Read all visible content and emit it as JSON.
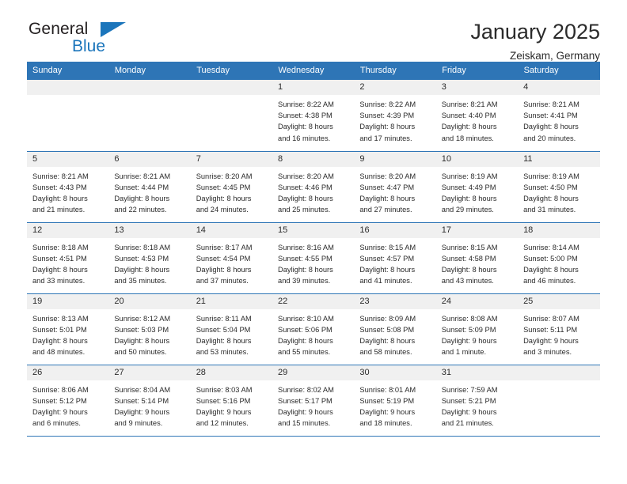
{
  "brand": {
    "line1": "General",
    "line2": "Blue",
    "triangle_icon": "blue-triangle-icon",
    "color_dark": "#231f20",
    "color_blue": "#1b75bb"
  },
  "header": {
    "title": "January 2025",
    "subtitle": "Zeiskam, Germany"
  },
  "colors": {
    "header_row": "#2e75b6",
    "daynum_band": "#f0f0f0",
    "text": "#2b2b2b"
  },
  "weekday_headers": [
    "Sunday",
    "Monday",
    "Tuesday",
    "Wednesday",
    "Thursday",
    "Friday",
    "Saturday"
  ],
  "weeks": [
    [
      {
        "day": "",
        "sunrise": "",
        "sunset": "",
        "daylight1": "",
        "daylight2": ""
      },
      {
        "day": "",
        "sunrise": "",
        "sunset": "",
        "daylight1": "",
        "daylight2": ""
      },
      {
        "day": "",
        "sunrise": "",
        "sunset": "",
        "daylight1": "",
        "daylight2": ""
      },
      {
        "day": "1",
        "sunrise": "Sunrise: 8:22 AM",
        "sunset": "Sunset: 4:38 PM",
        "daylight1": "Daylight: 8 hours",
        "daylight2": "and 16 minutes."
      },
      {
        "day": "2",
        "sunrise": "Sunrise: 8:22 AM",
        "sunset": "Sunset: 4:39 PM",
        "daylight1": "Daylight: 8 hours",
        "daylight2": "and 17 minutes."
      },
      {
        "day": "3",
        "sunrise": "Sunrise: 8:21 AM",
        "sunset": "Sunset: 4:40 PM",
        "daylight1": "Daylight: 8 hours",
        "daylight2": "and 18 minutes."
      },
      {
        "day": "4",
        "sunrise": "Sunrise: 8:21 AM",
        "sunset": "Sunset: 4:41 PM",
        "daylight1": "Daylight: 8 hours",
        "daylight2": "and 20 minutes."
      }
    ],
    [
      {
        "day": "5",
        "sunrise": "Sunrise: 8:21 AM",
        "sunset": "Sunset: 4:43 PM",
        "daylight1": "Daylight: 8 hours",
        "daylight2": "and 21 minutes."
      },
      {
        "day": "6",
        "sunrise": "Sunrise: 8:21 AM",
        "sunset": "Sunset: 4:44 PM",
        "daylight1": "Daylight: 8 hours",
        "daylight2": "and 22 minutes."
      },
      {
        "day": "7",
        "sunrise": "Sunrise: 8:20 AM",
        "sunset": "Sunset: 4:45 PM",
        "daylight1": "Daylight: 8 hours",
        "daylight2": "and 24 minutes."
      },
      {
        "day": "8",
        "sunrise": "Sunrise: 8:20 AM",
        "sunset": "Sunset: 4:46 PM",
        "daylight1": "Daylight: 8 hours",
        "daylight2": "and 25 minutes."
      },
      {
        "day": "9",
        "sunrise": "Sunrise: 8:20 AM",
        "sunset": "Sunset: 4:47 PM",
        "daylight1": "Daylight: 8 hours",
        "daylight2": "and 27 minutes."
      },
      {
        "day": "10",
        "sunrise": "Sunrise: 8:19 AM",
        "sunset": "Sunset: 4:49 PM",
        "daylight1": "Daylight: 8 hours",
        "daylight2": "and 29 minutes."
      },
      {
        "day": "11",
        "sunrise": "Sunrise: 8:19 AM",
        "sunset": "Sunset: 4:50 PM",
        "daylight1": "Daylight: 8 hours",
        "daylight2": "and 31 minutes."
      }
    ],
    [
      {
        "day": "12",
        "sunrise": "Sunrise: 8:18 AM",
        "sunset": "Sunset: 4:51 PM",
        "daylight1": "Daylight: 8 hours",
        "daylight2": "and 33 minutes."
      },
      {
        "day": "13",
        "sunrise": "Sunrise: 8:18 AM",
        "sunset": "Sunset: 4:53 PM",
        "daylight1": "Daylight: 8 hours",
        "daylight2": "and 35 minutes."
      },
      {
        "day": "14",
        "sunrise": "Sunrise: 8:17 AM",
        "sunset": "Sunset: 4:54 PM",
        "daylight1": "Daylight: 8 hours",
        "daylight2": "and 37 minutes."
      },
      {
        "day": "15",
        "sunrise": "Sunrise: 8:16 AM",
        "sunset": "Sunset: 4:55 PM",
        "daylight1": "Daylight: 8 hours",
        "daylight2": "and 39 minutes."
      },
      {
        "day": "16",
        "sunrise": "Sunrise: 8:15 AM",
        "sunset": "Sunset: 4:57 PM",
        "daylight1": "Daylight: 8 hours",
        "daylight2": "and 41 minutes."
      },
      {
        "day": "17",
        "sunrise": "Sunrise: 8:15 AM",
        "sunset": "Sunset: 4:58 PM",
        "daylight1": "Daylight: 8 hours",
        "daylight2": "and 43 minutes."
      },
      {
        "day": "18",
        "sunrise": "Sunrise: 8:14 AM",
        "sunset": "Sunset: 5:00 PM",
        "daylight1": "Daylight: 8 hours",
        "daylight2": "and 46 minutes."
      }
    ],
    [
      {
        "day": "19",
        "sunrise": "Sunrise: 8:13 AM",
        "sunset": "Sunset: 5:01 PM",
        "daylight1": "Daylight: 8 hours",
        "daylight2": "and 48 minutes."
      },
      {
        "day": "20",
        "sunrise": "Sunrise: 8:12 AM",
        "sunset": "Sunset: 5:03 PM",
        "daylight1": "Daylight: 8 hours",
        "daylight2": "and 50 minutes."
      },
      {
        "day": "21",
        "sunrise": "Sunrise: 8:11 AM",
        "sunset": "Sunset: 5:04 PM",
        "daylight1": "Daylight: 8 hours",
        "daylight2": "and 53 minutes."
      },
      {
        "day": "22",
        "sunrise": "Sunrise: 8:10 AM",
        "sunset": "Sunset: 5:06 PM",
        "daylight1": "Daylight: 8 hours",
        "daylight2": "and 55 minutes."
      },
      {
        "day": "23",
        "sunrise": "Sunrise: 8:09 AM",
        "sunset": "Sunset: 5:08 PM",
        "daylight1": "Daylight: 8 hours",
        "daylight2": "and 58 minutes."
      },
      {
        "day": "24",
        "sunrise": "Sunrise: 8:08 AM",
        "sunset": "Sunset: 5:09 PM",
        "daylight1": "Daylight: 9 hours",
        "daylight2": "and 1 minute."
      },
      {
        "day": "25",
        "sunrise": "Sunrise: 8:07 AM",
        "sunset": "Sunset: 5:11 PM",
        "daylight1": "Daylight: 9 hours",
        "daylight2": "and 3 minutes."
      }
    ],
    [
      {
        "day": "26",
        "sunrise": "Sunrise: 8:06 AM",
        "sunset": "Sunset: 5:12 PM",
        "daylight1": "Daylight: 9 hours",
        "daylight2": "and 6 minutes."
      },
      {
        "day": "27",
        "sunrise": "Sunrise: 8:04 AM",
        "sunset": "Sunset: 5:14 PM",
        "daylight1": "Daylight: 9 hours",
        "daylight2": "and 9 minutes."
      },
      {
        "day": "28",
        "sunrise": "Sunrise: 8:03 AM",
        "sunset": "Sunset: 5:16 PM",
        "daylight1": "Daylight: 9 hours",
        "daylight2": "and 12 minutes."
      },
      {
        "day": "29",
        "sunrise": "Sunrise: 8:02 AM",
        "sunset": "Sunset: 5:17 PM",
        "daylight1": "Daylight: 9 hours",
        "daylight2": "and 15 minutes."
      },
      {
        "day": "30",
        "sunrise": "Sunrise: 8:01 AM",
        "sunset": "Sunset: 5:19 PM",
        "daylight1": "Daylight: 9 hours",
        "daylight2": "and 18 minutes."
      },
      {
        "day": "31",
        "sunrise": "Sunrise: 7:59 AM",
        "sunset": "Sunset: 5:21 PM",
        "daylight1": "Daylight: 9 hours",
        "daylight2": "and 21 minutes."
      },
      {
        "day": "",
        "sunrise": "",
        "sunset": "",
        "daylight1": "",
        "daylight2": ""
      }
    ]
  ]
}
